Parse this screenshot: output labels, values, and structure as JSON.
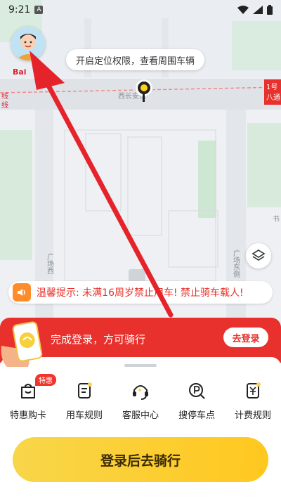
{
  "status_bar": {
    "time": "9:21",
    "notification_glyph": "A"
  },
  "map": {
    "labels": {
      "road_left_1": "线",
      "road_left_2": "线",
      "road_right_1": "1号",
      "road_right_2": "八通",
      "street": "西长安街",
      "square_west": "广场西",
      "square_east": "广场东侧",
      "right_edge": "书"
    },
    "logo": "Bai",
    "location_tip": "开启定位权限，查看周围车辆"
  },
  "notice": {
    "text": "温馨提示: 未满16周岁禁止用车! 禁止骑车载人!"
  },
  "login_bar": {
    "message": "完成登录，方可骑行",
    "button_label": "去登录"
  },
  "tools": [
    {
      "label": "特惠购卡",
      "badge": "特惠",
      "icon": "shopping-bag-icon"
    },
    {
      "label": "用车规则",
      "icon": "rules-icon"
    },
    {
      "label": "客服中心",
      "icon": "headset-icon"
    },
    {
      "label": "搜停车点",
      "icon": "parking-search-icon"
    },
    {
      "label": "计费规则",
      "icon": "pricing-icon"
    }
  ],
  "primary_action": {
    "label": "登录后去骑行"
  },
  "colors": {
    "accent_red": "#e8312c",
    "accent_yellow": "#ffc81e",
    "arrow_red": "#e5232b"
  }
}
